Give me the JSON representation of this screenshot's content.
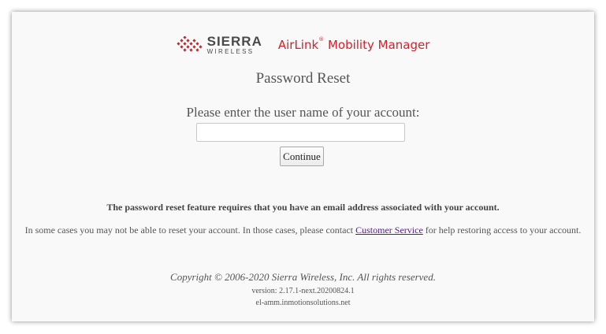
{
  "branding": {
    "company_top": "SIERRA",
    "company_bottom": "WIRELESS",
    "product_name": "AirLink",
    "product_reg": "®",
    "product_suffix": " Mobility Manager",
    "brand_red": "#d3202a"
  },
  "page": {
    "title": "Password Reset",
    "prompt": "Please enter the user name of your account:",
    "username_value": "",
    "continue_label": "Continue"
  },
  "notice": {
    "requirement": "The password reset feature requires that you have an email address associated with your account.",
    "help_before": "In some cases you may not be able to reset your account. In those cases, please contact ",
    "help_link": "Customer Service",
    "help_after": " for help restoring access to your account."
  },
  "footer": {
    "copyright": "Copyright © 2006-2020 Sierra Wireless, Inc. All rights reserved.",
    "version": "version: 2.17.1-next.20200824.1",
    "host": "el-amm.inmotionsolutions.net"
  }
}
